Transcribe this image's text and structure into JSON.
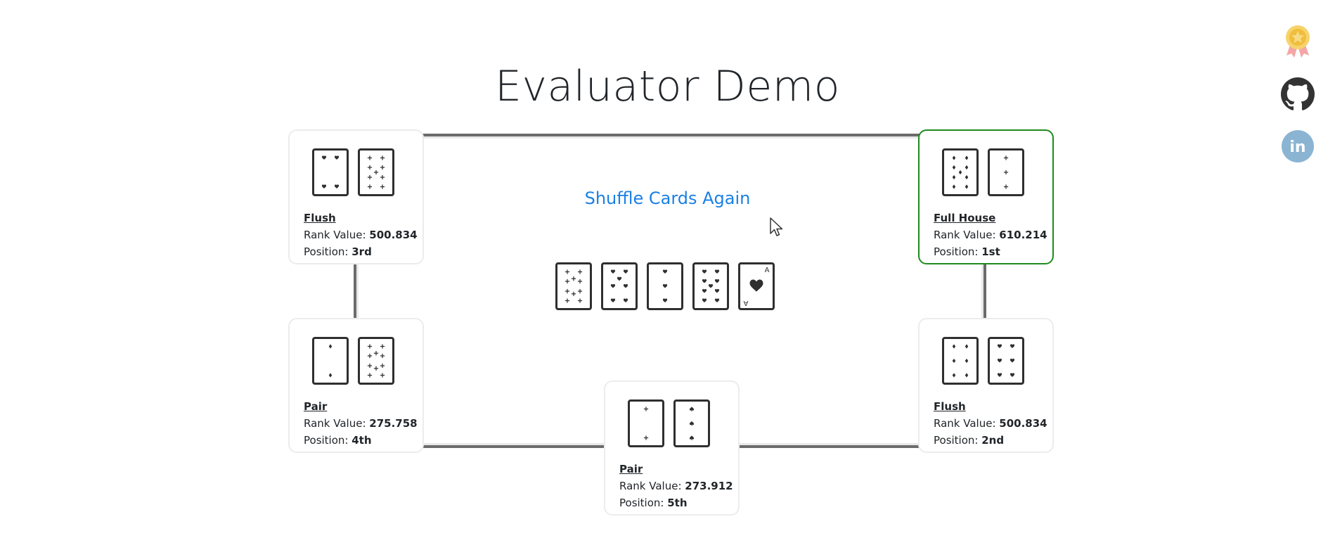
{
  "title": "Evaluator Demo",
  "shuffle_label": "Shuffle Cards Again",
  "board": [
    {
      "name": "board-card-ten-clubs",
      "suit": "club",
      "pips": 10
    },
    {
      "name": "board-card-seven-hearts",
      "suit": "heart",
      "pips": 7
    },
    {
      "name": "board-card-three-hearts",
      "suit": "heart",
      "pips": 3
    },
    {
      "name": "board-card-nine-hearts",
      "suit": "heart",
      "pips": 9
    },
    {
      "name": "board-card-ace-hearts",
      "suit": "heart",
      "pips": 1
    }
  ],
  "players": [
    {
      "id": "p1",
      "hand": "Flush",
      "rank_label": "Rank Value:",
      "rank": "500.834",
      "position_label": "Position:",
      "position": "3rd",
      "winner": false,
      "cards": [
        {
          "suit": "heart",
          "pips": 4
        },
        {
          "suit": "club",
          "pips": 9
        }
      ]
    },
    {
      "id": "p2",
      "hand": "Full House",
      "rank_label": "Rank Value:",
      "rank": "610.214",
      "position_label": "Position:",
      "position": "1st",
      "winner": true,
      "cards": [
        {
          "suit": "diamond",
          "pips": 9
        },
        {
          "suit": "club",
          "pips": 3
        }
      ]
    },
    {
      "id": "p3",
      "hand": "Pair",
      "rank_label": "Rank Value:",
      "rank": "275.758",
      "position_label": "Position:",
      "position": "4th",
      "winner": false,
      "cards": [
        {
          "suit": "diamond",
          "pips": 2
        },
        {
          "suit": "club",
          "pips": 10
        }
      ]
    },
    {
      "id": "p4",
      "hand": "Flush",
      "rank_label": "Rank Value:",
      "rank": "500.834",
      "position_label": "Position:",
      "position": "2nd",
      "winner": false,
      "cards": [
        {
          "suit": "diamond",
          "pips": 6
        },
        {
          "suit": "heart",
          "pips": 6
        }
      ]
    },
    {
      "id": "p5",
      "hand": "Pair",
      "rank_label": "Rank Value:",
      "rank": "273.912",
      "position_label": "Position:",
      "position": "5th",
      "winner": false,
      "cards": [
        {
          "suit": "club",
          "pips": 2
        },
        {
          "suit": "spade",
          "pips": 3
        }
      ]
    }
  ],
  "ace_label": "A",
  "social": [
    {
      "name": "award-icon",
      "color": "#f1c40f"
    },
    {
      "name": "github-icon",
      "color": "#333333"
    },
    {
      "name": "linkedin-icon",
      "color": "#8ab4d2",
      "label": "in"
    }
  ]
}
